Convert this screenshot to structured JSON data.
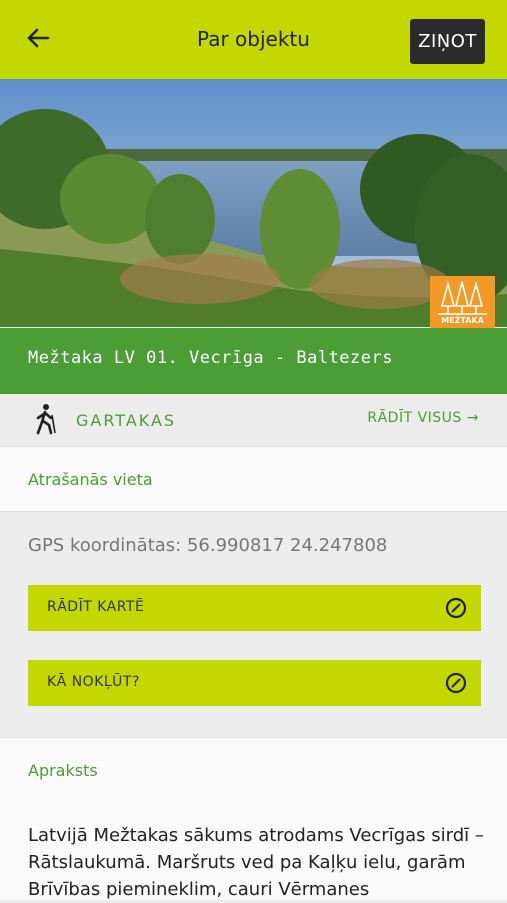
{
  "header": {
    "back_label": "back",
    "title": "Par objektu",
    "report_label": "ZIŅOT"
  },
  "hero": {
    "logo_text": "MEŽTAKA",
    "logo_color": "#f39a26"
  },
  "object": {
    "name": "Mežtaka LV 01. Vecrīga - Baltezers"
  },
  "category": {
    "icon": "hiker-icon",
    "label": "GARTAKAS",
    "show_all": "RĀDĪT VISUS →"
  },
  "location": {
    "section_title": "Atrašanās vieta",
    "gps_text": "GPS koordinātas: 56.990817 24.247808",
    "show_map": "RĀDĪT KARTĒ",
    "how_to_get": "KĀ NOKĻŪT?"
  },
  "description": {
    "section_title": "Apraksts",
    "text": "Latvijā Mežtakas sākums atrodams Vecrīgas sirdī – Rātslaukumā. Maršruts ved pa Kaļķu ielu, garām Brīvības piemineklim, cauri Vērmanes"
  },
  "colors": {
    "lime": "#c3d800",
    "green": "#4a9e35",
    "dark": "#2b2b2b"
  }
}
